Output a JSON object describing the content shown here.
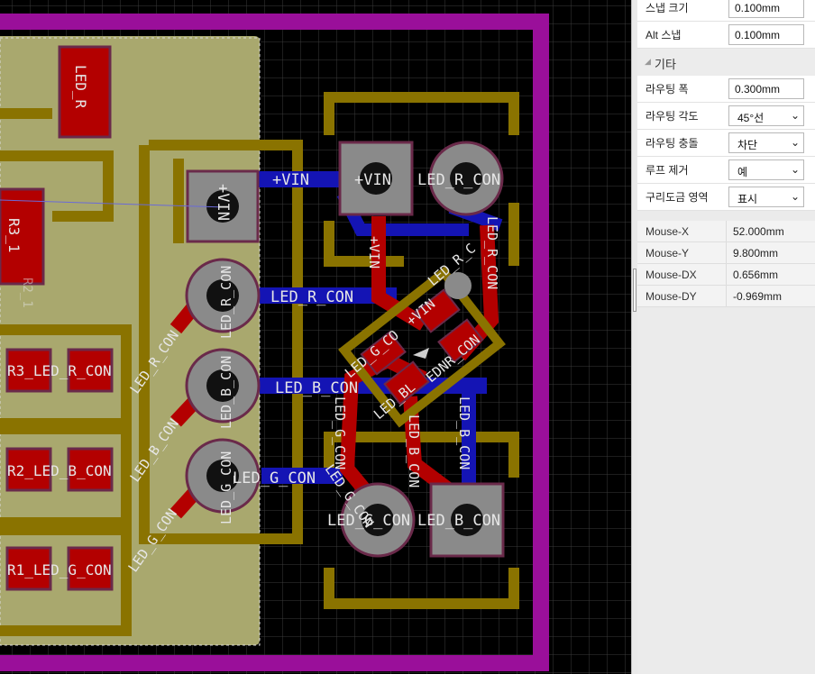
{
  "properties": {
    "snap_size": {
      "label": "스냅 크기",
      "value": "0.100mm"
    },
    "alt_snap": {
      "label": "Alt 스냅",
      "value": "0.100mm"
    },
    "misc_section": "기타",
    "routing_width": {
      "label": "라우팅 폭",
      "value": "0.300mm"
    },
    "routing_angle": {
      "label": "라우팅 각도",
      "value": "45°선"
    },
    "routing_conflict": {
      "label": "라우팅 충돌",
      "value": "차단"
    },
    "loop_removal": {
      "label": "루프 제거",
      "value": "예"
    },
    "copper_pour": {
      "label": "구리도금 영역",
      "value": "표시"
    }
  },
  "mouse": {
    "x": {
      "label": "Mouse-X",
      "value": "52.000mm"
    },
    "y": {
      "label": "Mouse-Y",
      "value": "9.800mm"
    },
    "dx": {
      "label": "Mouse-DX",
      "value": "0.656mm"
    },
    "dy": {
      "label": "Mouse-DY",
      "value": "-0.969mm"
    }
  },
  "pcb": {
    "colors": {
      "board_outline": "#9a0f9a",
      "silkscreen": "#8a7300",
      "top_copper": "#b30000",
      "bottom_copper": "#1414b4",
      "pour": "#a9a86e",
      "pad": "#8a8a8a"
    },
    "labels": {
      "led_r": "LED_R",
      "r3": "R3_1",
      "r2_ghost": "R2_1",
      "vin": "+VIN",
      "led_r_con": "LED_R_CON",
      "led_b_con": "LED_B_CON",
      "led_g_con": "LED_G_CON",
      "r3_led_r": "R3_LED_R_CON",
      "r2_led_b": "R2_LED_B_CON",
      "r1_led_g": "R1_LED_G_CON",
      "led_g_co": "LED_G_CO",
      "led_bl": "LED_BL",
      "ednr_con": "EDNR_CON",
      "led_r_c": "LED_R_C",
      "g_con_rot": "LED_G_CON",
      "b_con_rot": "LED_B_CON",
      "r_con_rot": "LED_R_CON",
      "vin_rot": "+VIN",
      "vin_diag": "+VIN"
    }
  }
}
